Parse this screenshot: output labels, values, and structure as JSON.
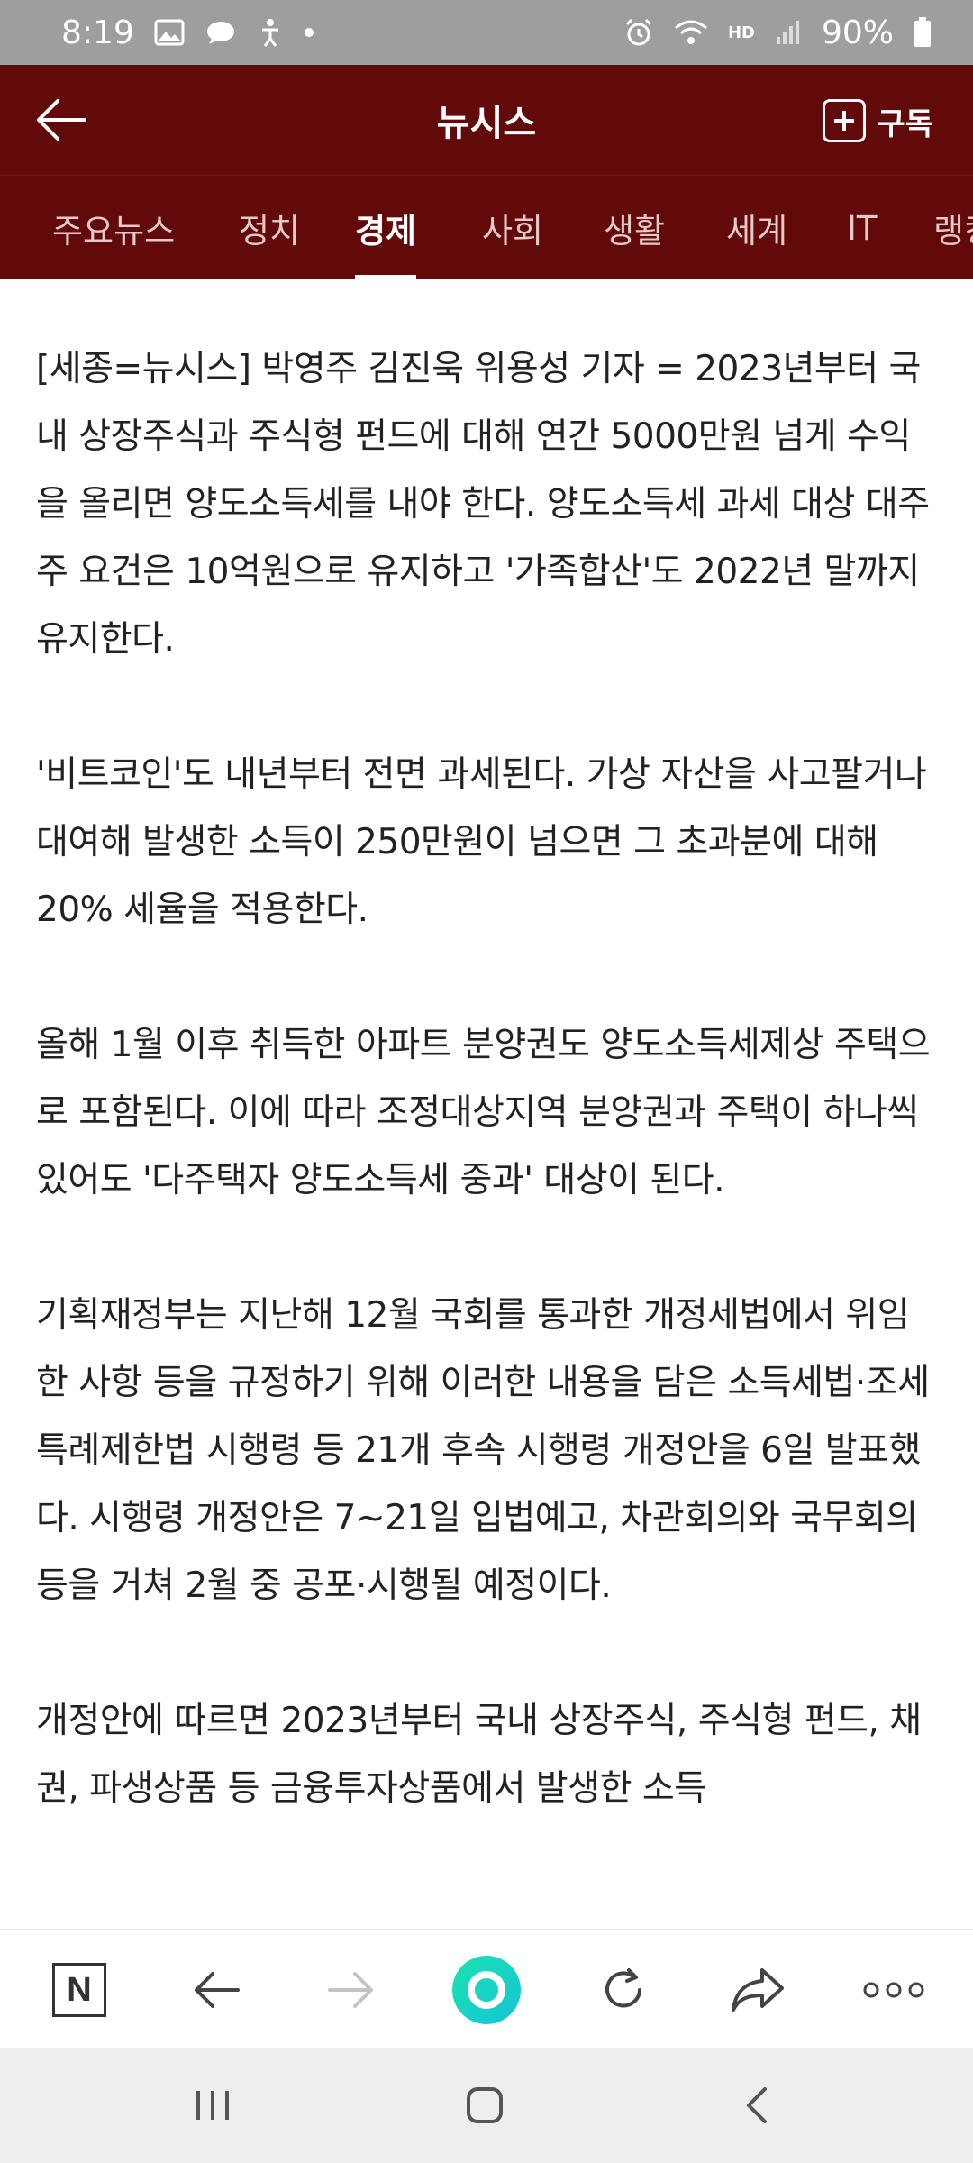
{
  "status_bar": {
    "time": "8:19",
    "battery": "90%",
    "network_label": "HD"
  },
  "header": {
    "title": "뉴시스",
    "subscribe_label": "구독"
  },
  "tabs": [
    {
      "label": "주요뉴스",
      "active": false
    },
    {
      "label": "정치",
      "active": false
    },
    {
      "label": "경제",
      "active": true
    },
    {
      "label": "사회",
      "active": false
    },
    {
      "label": "생활",
      "active": false
    },
    {
      "label": "세계",
      "active": false
    },
    {
      "label": "IT",
      "active": false
    },
    {
      "label": "랭킹",
      "active": false
    }
  ],
  "article": {
    "paragraphs": [
      "[세종=뉴시스] 박영주 김진욱 위용성 기자 = 2023년부터 국내 상장주식과 주식형 펀드에 대해 연간 5000만원 넘게 수익을 올리면 양도소득세를 내야 한다. 양도소득세 과세 대상 대주주 요건은 10억원으로 유지하고 '가족합산'도 2022년 말까지 유지한다.",
      "'비트코인'도 내년부터 전면 과세된다. 가상 자산을 사고팔거나 대여해 발생한 소득이 250만원이 넘으면 그 초과분에 대해 20% 세율을 적용한다.",
      "올해 1월 이후 취득한 아파트 분양권도 양도소득세제상 주택으로 포함된다. 이에 따라 조정대상지역 분양권과 주택이 하나씩 있어도 '다주택자 양도소득세 중과' 대상이 된다.",
      "기획재정부는 지난해 12월 국회를 통과한 개정세법에서 위임한 사항 등을 규정하기 위해 이러한 내용을 담은 소득세법·조세특례제한법 시행령 등 21개 후속 시행령 개정안을 6일 발표했다. 시행령 개정안은 7~21일 입법예고, 차관회의와 국무회의 등을 거쳐 2월 중 공포·시행될 예정이다.",
      "개정안에 따르면 2023년부터 국내 상장주식, 주식형 펀드, 채권, 파생상품 등 금융투자상품에서 발생한 소득"
    ]
  },
  "toolbar": {
    "home_label": "N"
  },
  "colors": {
    "brand": "#620a0a",
    "status_bar": "#9e9e9e",
    "accent_green": "#1fd6a6"
  }
}
